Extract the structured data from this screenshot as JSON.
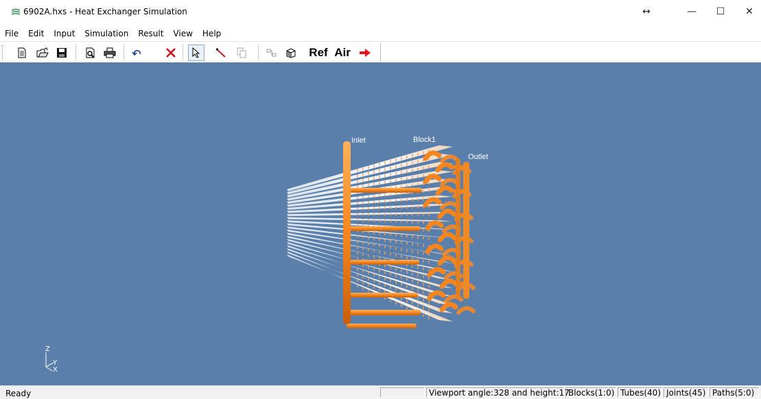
{
  "window": {
    "title": "6902A.hxs - Heat Exchanger Simulation",
    "controls": {
      "extra": "↔",
      "minimize": "—",
      "maximize": "☐",
      "close": "✕"
    }
  },
  "menu": [
    "File",
    "Edit",
    "Input",
    "Simulation",
    "Result",
    "View",
    "Help"
  ],
  "toolbar": {
    "buttons": [
      "new-file-icon",
      "open-folder-icon",
      "save-icon",
      "print-preview-icon",
      "print-icon",
      "undo-icon",
      "delete-icon",
      "select-pointer-icon",
      "draw-tube-icon",
      "copy-icon",
      "connect-icon",
      "block-icon"
    ],
    "ref_label": "Ref",
    "air_label": "Air",
    "run_icon": "red-arrow-icon"
  },
  "viewport": {
    "background": "#5a7fab",
    "labels": {
      "inlet": "Inlet",
      "block": "Block1",
      "outlet": "Outlet"
    },
    "axis": {
      "z": "Z",
      "y": "Y",
      "x": "X"
    }
  },
  "status": {
    "ready": "Ready",
    "panes": [
      "",
      "Viewport angle:328 and height:17",
      "Blocks(1:0)",
      "Tubes(40)",
      "Joints(45)",
      "Paths(5:0)"
    ]
  },
  "colors": {
    "pipe": "#f5861f",
    "fin": "#f2f2f2",
    "viewport": "#5a7fab"
  }
}
